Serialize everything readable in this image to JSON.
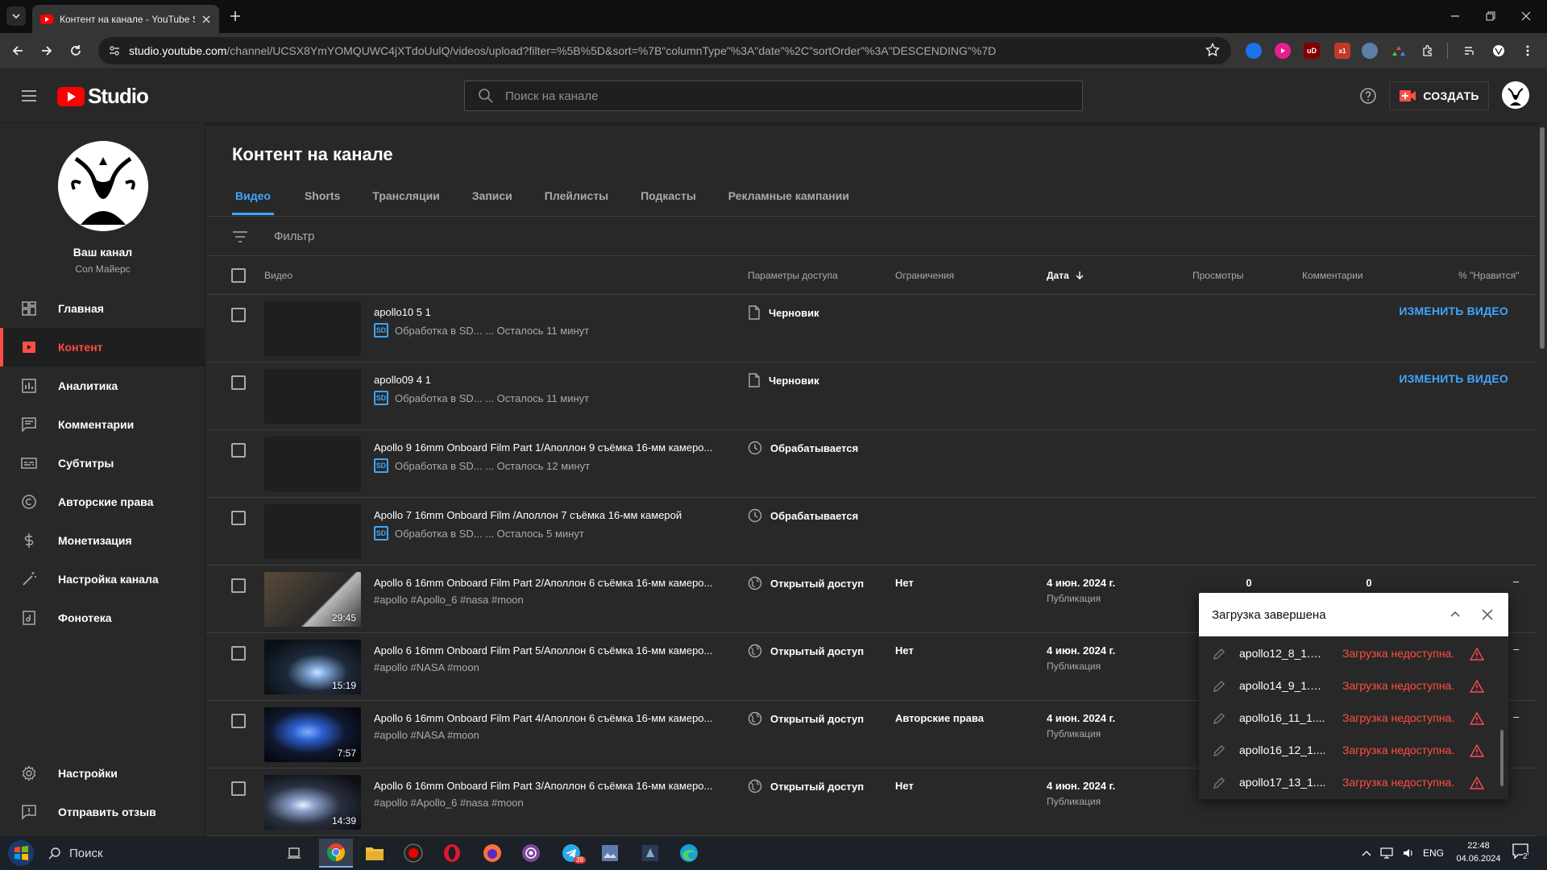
{
  "browser": {
    "tab_title": "Контент на канале - YouTube S",
    "url_host": "studio.youtube.com",
    "url_path": "/channel/UCSX8YmYOMQUWC4jXTdoUulQ/videos/upload?filter=%5B%5D&sort=%7B\"columnType\"%3A\"date\"%2C\"sortOrder\"%3A\"DESCENDING\"%7D",
    "ext_badge": "x1"
  },
  "header": {
    "logo_text": "Studio",
    "search_placeholder": "Поиск на канале",
    "create_label": "СОЗДАТЬ"
  },
  "sidebar": {
    "channel_name": "Ваш канал",
    "channel_owner": "Сол Майерс",
    "items": [
      {
        "label": "Главная",
        "icon": "dashboard-icon"
      },
      {
        "label": "Контент",
        "icon": "content-icon",
        "active": true
      },
      {
        "label": "Аналитика",
        "icon": "analytics-icon"
      },
      {
        "label": "Комментарии",
        "icon": "comments-icon"
      },
      {
        "label": "Субтитры",
        "icon": "subtitles-icon"
      },
      {
        "label": "Авторские права",
        "icon": "copyright-icon"
      },
      {
        "label": "Монетизация",
        "icon": "monetization-icon"
      },
      {
        "label": "Настройка канала",
        "icon": "customization-icon"
      },
      {
        "label": "Фонотека",
        "icon": "audio-library-icon"
      }
    ],
    "bottom_items": [
      {
        "label": "Настройки",
        "icon": "settings-icon"
      },
      {
        "label": "Отправить отзыв",
        "icon": "feedback-icon"
      }
    ]
  },
  "main": {
    "title": "Контент на канале",
    "tabs": [
      "Видео",
      "Shorts",
      "Трансляции",
      "Записи",
      "Плейлисты",
      "Подкасты",
      "Рекламные кампании"
    ],
    "filter_placeholder": "Фильтр",
    "columns": {
      "video": "Видео",
      "visibility": "Параметры доступа",
      "restrictions": "Ограничения",
      "date": "Дата",
      "views": "Просмотры",
      "comments": "Комментарии",
      "likes": "% \"Нравится\""
    },
    "rows": [
      {
        "title": "apollo10 5 1",
        "sub": "Обработка в SD... ... Осталось 11 минут",
        "visibility": "Черновик",
        "vis_icon": "draft-icon",
        "edit": "ИЗМЕНИТЬ ВИДЕО"
      },
      {
        "title": "apollo09 4 1",
        "sub": "Обработка в SD... ... Осталось 11 минут",
        "visibility": "Черновик",
        "vis_icon": "draft-icon",
        "edit": "ИЗМЕНИТЬ ВИДЕО"
      },
      {
        "title": "Apollo 9 16mm Onboard Film Part 1/Аполлон 9 съёмка 16-мм камеро...",
        "sub": "Обработка в SD... ... Осталось 12 минут",
        "visibility": "Обрабатывается",
        "vis_icon": "clock-icon"
      },
      {
        "title": "Apollo 7 16mm Onboard Film /Аполлон 7 съёмка 16-мм камерой",
        "sub": "Обработка в SD... ... Осталось 5 минут",
        "visibility": "Обрабатывается",
        "vis_icon": "clock-icon"
      },
      {
        "title": "Apollo 6 16mm Onboard Film Part 2/Аполлон 6 съёмка 16-мм камеро...",
        "tags": "#apollo #Apollo_6 #nasa #moon",
        "duration": "29:45",
        "visibility": "Открытый доступ",
        "vis_icon": "public-icon",
        "restrictions": "Нет",
        "date": "4 июн. 2024 г.",
        "date_sub": "Публикация",
        "views": "0",
        "comments": "0",
        "likes": "–"
      },
      {
        "title": "Apollo 6 16mm Onboard Film Part 5/Аполлон 6 съёмка 16-мм камеро...",
        "tags": "#apollo #NASA #moon",
        "duration": "15:19",
        "visibility": "Открытый доступ",
        "vis_icon": "public-icon",
        "restrictions": "Нет",
        "date": "4 июн. 2024 г.",
        "date_sub": "Публикация",
        "likes": "–"
      },
      {
        "title": "Apollo 6 16mm Onboard Film Part 4/Аполлон 6 съёмка 16-мм камеро...",
        "tags": "#apollo #NASA #moon",
        "duration": "7:57",
        "visibility": "Открытый доступ",
        "vis_icon": "public-icon",
        "restrictions": "Авторские права",
        "date": "4 июн. 2024 г.",
        "date_sub": "Публикация",
        "likes": "–"
      },
      {
        "title": "Apollo 6 16mm Onboard Film Part 3/Аполлон 6 съёмка 16-мм камеро...",
        "tags": "#apollo #Apollo_6 #nasa #moon",
        "duration": "14:39",
        "visibility": "Открытый доступ",
        "vis_icon": "public-icon",
        "restrictions": "Нет",
        "date": "4 июн. 2024 г.",
        "date_sub": "Публикация",
        "likes": "–"
      }
    ]
  },
  "upload_popup": {
    "title": "Загрузка завершена",
    "items": [
      {
        "file": "apollo12_8_1.m...",
        "status": "Загрузка недоступна."
      },
      {
        "file": "apollo14_9_1.m...",
        "status": "Загрузка недоступна."
      },
      {
        "file": "apollo16_11_1....",
        "status": "Загрузка недоступна."
      },
      {
        "file": "apollo16_12_1....",
        "status": "Загрузка недоступна."
      },
      {
        "file": "apollo17_13_1....",
        "status": "Загрузка недоступна."
      }
    ]
  },
  "taskbar": {
    "search_label": "Поиск",
    "lang": "ENG",
    "time": "22:48",
    "date": "04.06.2024",
    "notif_count": "2",
    "telegram_badge": "39"
  },
  "colors": {
    "accent": "#3ea6ff",
    "active_nav": "#ff4e45",
    "error": "#ff4e45",
    "bg": "#282828"
  }
}
